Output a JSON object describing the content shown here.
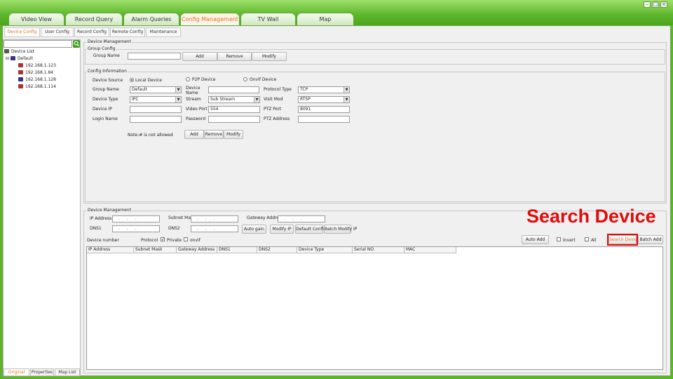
{
  "main_tabs": [
    {
      "label": "Video View"
    },
    {
      "label": "Record Query"
    },
    {
      "label": "Alarm Queries"
    },
    {
      "label": "Config Management",
      "active": true
    },
    {
      "label": "TV Wall"
    },
    {
      "label": "Map"
    }
  ],
  "sub_tabs": [
    "Device Config",
    "User Config",
    "Record Config",
    "Remote Config",
    "Maintenance"
  ],
  "left_panel": {
    "search_placeholder": "",
    "tree_root": "Device List",
    "group": "Default",
    "devices": [
      "192.168.1.123",
      "192.168.1.84",
      "192.168.1.128",
      "192.168.1.114"
    ],
    "bottom_tabs": [
      "Original",
      "Properties",
      "Map List"
    ]
  },
  "device_management": {
    "title": "Device Management",
    "group_config": {
      "title": "Group Config",
      "group_name_label": "Group Name",
      "group_name_value": "",
      "add": "Add",
      "remove": "Remove",
      "modify": "Modify"
    },
    "config_info": {
      "title": "Config Information",
      "device_source_label": "Device Source",
      "source_options": [
        "Local Device",
        "P2P Device",
        "Onvif Device"
      ],
      "selected_source": "Local Device",
      "group_name_label": "Group Name",
      "group_name_value": "Default",
      "device_name_label": "Device Name",
      "device_name_value": "",
      "protocol_type_label": "Protocol Type",
      "protocol_type_value": "TCP",
      "device_type_label": "Device Type",
      "device_type_value": "IPC",
      "stream_label": "Stream",
      "stream_value": "Sub Stream",
      "visit_mod_label": "Visit Mod",
      "visit_mod_value": "RTSP",
      "device_ip_label": "Device IP",
      "device_ip_value": "",
      "video_port_label": "Video Port",
      "video_port_value": "554",
      "ptz_port_label": "PTZ Port",
      "ptz_port_value": "8091",
      "login_name_label": "Login Name",
      "login_name_value": "",
      "password_label": "Password",
      "password_value": "",
      "ptz_address_label": "PTZ Address",
      "ptz_address_value": "",
      "note": "Note:# is not allowed",
      "add": "Add",
      "remove": "Remove",
      "modify": "Modify"
    }
  },
  "search_section": {
    "title": "Device Management",
    "ip_address_label": "IP Address",
    "subnet_mask_label": "Subnet Mask",
    "gateway_label": "Gateway Address",
    "dns1_label": "DNS1",
    "dns2_label": "DNS2",
    "ip_placeholder": "...",
    "auto_gain": "Auto gain",
    "modify_ip": "Modify IP",
    "default_config": "Default Config",
    "batch_modify_ip": "Batch Modify IP",
    "device_number_label": "Device number",
    "protocol_label": "Protocol",
    "private_label": "Private",
    "private_checked": true,
    "onvif_label": "onvif",
    "onvif_checked": false,
    "auto_add": "Auto Add",
    "invert_label": "Invert",
    "all_label": "All",
    "search_device": "Search Device",
    "batch_add": "Batch Add",
    "columns": [
      "IP Address",
      "Subnet Mask",
      "Gateway Address",
      "DNS1",
      "DNS2",
      "Device Type",
      "Serial NO.",
      "MAC"
    ]
  },
  "annotation": {
    "text": "Search Device",
    "color": "#e10b0b"
  },
  "colors": {
    "frame_green": "#5db52a",
    "active_tab_text": "#e8741e",
    "panel_bg": "#f0f0f0"
  }
}
